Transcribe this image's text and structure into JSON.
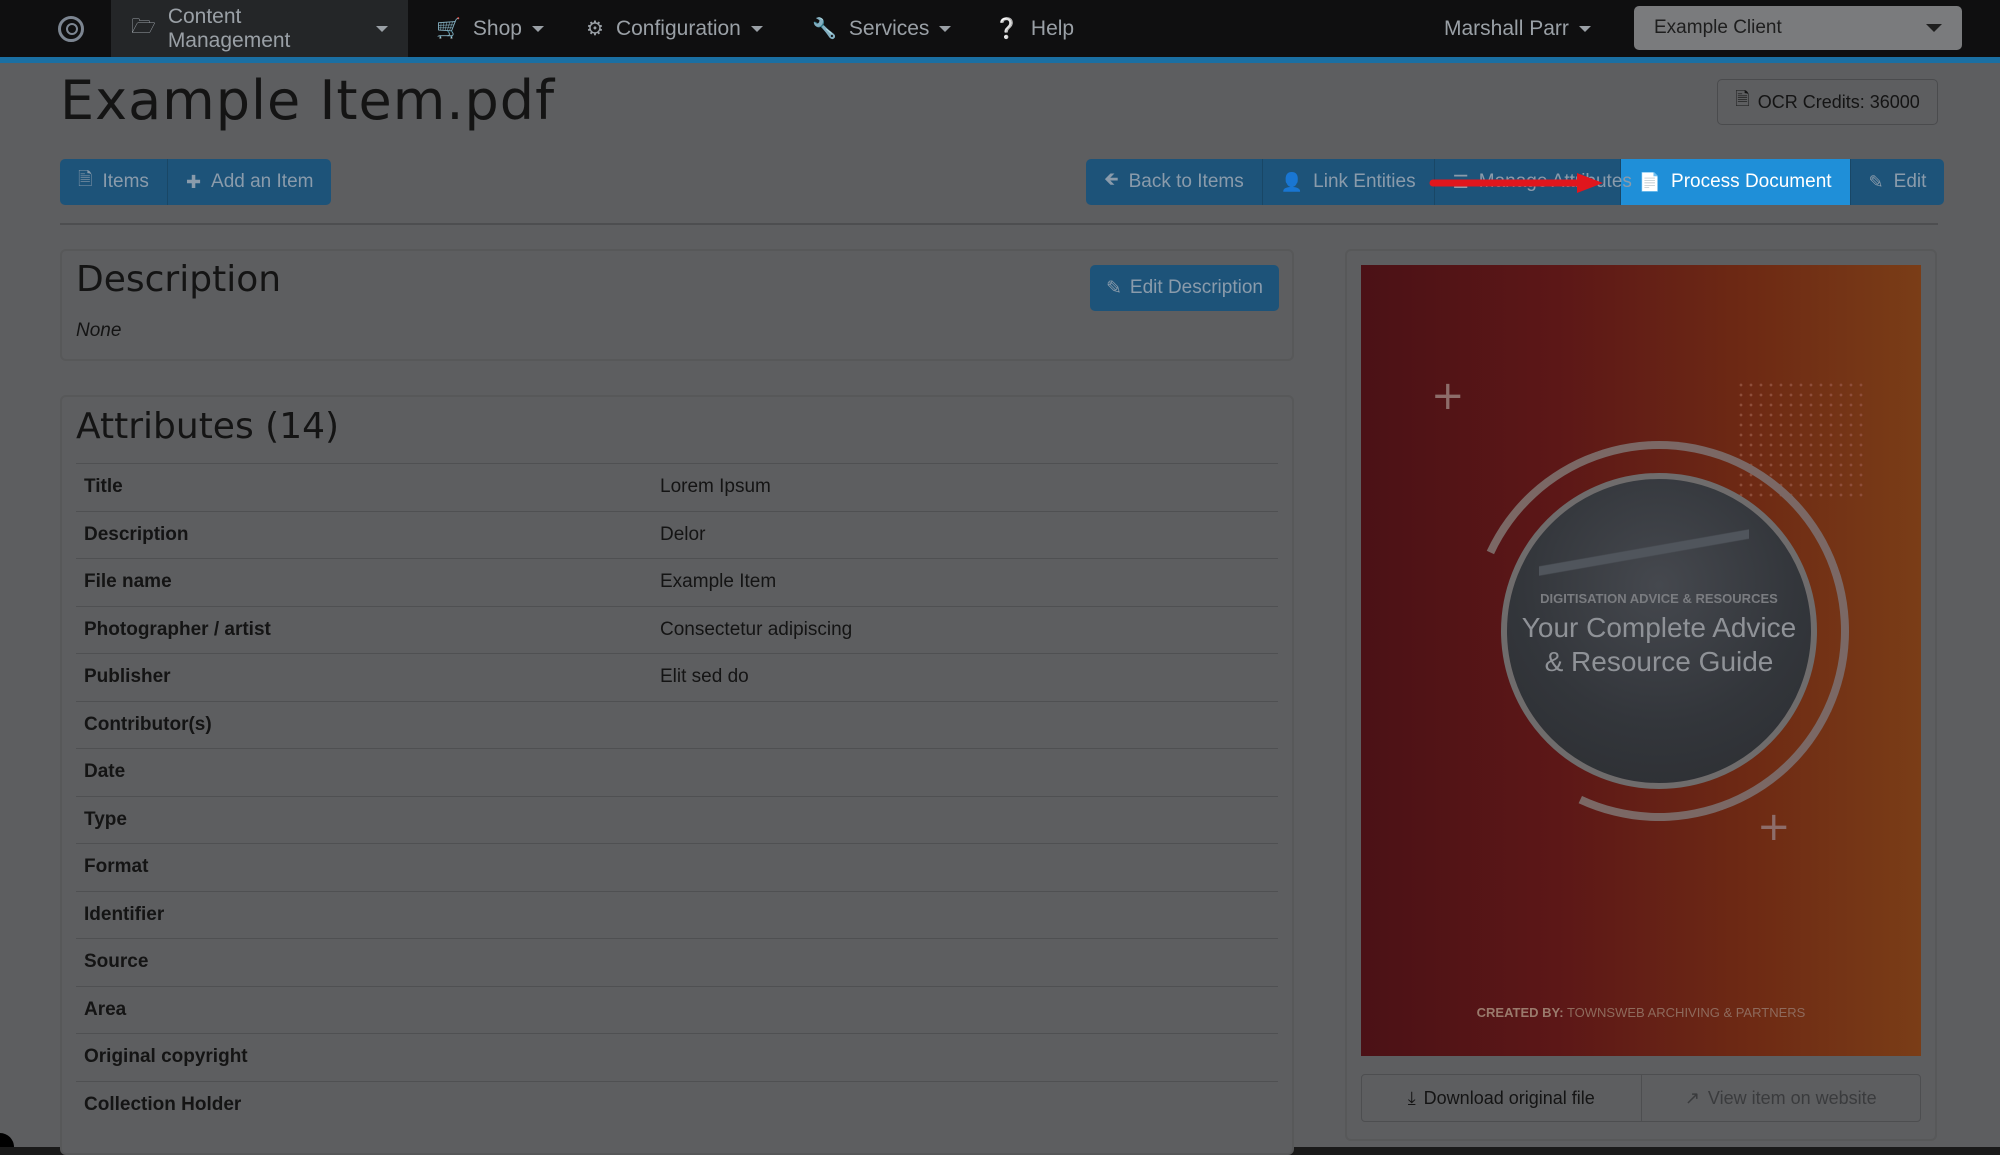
{
  "nav": {
    "items": [
      {
        "label": "Content Management",
        "icon": "folder-open-icon"
      },
      {
        "label": "Shop",
        "icon": "cart-icon"
      },
      {
        "label": "Configuration",
        "icon": "cog-icon"
      },
      {
        "label": "Services",
        "icon": "wrench-icon"
      },
      {
        "label": "Help",
        "icon": "question-circle-icon"
      }
    ],
    "user": "Marshall Parr",
    "client_select": "Example Client"
  },
  "page": {
    "title": "Example Item.pdf",
    "ocr_credits": "OCR Credits: 36000"
  },
  "toolbar_left": {
    "items_label": "Items",
    "add_item_label": "Add an Item"
  },
  "toolbar_right": {
    "back_label": "Back to Items",
    "link_entities_label": "Link Entities",
    "manage_attributes_label": "Manage Attributes",
    "process_document_label": "Process Document",
    "edit_label": "Edit"
  },
  "description": {
    "title": "Description",
    "value": "None",
    "edit_label": "Edit Description"
  },
  "attributes": {
    "title": "Attributes (14)",
    "rows": [
      {
        "key": "Title",
        "value": "Lorem Ipsum"
      },
      {
        "key": "Description",
        "value": "Delor"
      },
      {
        "key": "File name",
        "value": "Example Item"
      },
      {
        "key": "Photographer / artist",
        "value": "Consectetur adipiscing"
      },
      {
        "key": "Publisher",
        "value": "Elit sed do"
      },
      {
        "key": "Contributor(s)",
        "value": ""
      },
      {
        "key": "Date",
        "value": ""
      },
      {
        "key": "Type",
        "value": ""
      },
      {
        "key": "Format",
        "value": ""
      },
      {
        "key": "Identifier",
        "value": ""
      },
      {
        "key": "Source",
        "value": ""
      },
      {
        "key": "Area",
        "value": ""
      },
      {
        "key": "Original copyright",
        "value": ""
      },
      {
        "key": "Collection Holder",
        "value": ""
      }
    ]
  },
  "preview": {
    "kicker": "DIGITISATION ADVICE & RESOURCES",
    "title_line1": "Your Complete Advice",
    "title_line2": "& Resource Guide",
    "credit_prefix": "CREATED BY:",
    "credit_name": "TOWNSWEB ARCHIVING & PARTNERS",
    "download_label": "Download original file",
    "view_label": "View item on website"
  },
  "colors": {
    "accent": "#1f8fd8",
    "annotation_arrow": "#e0161d"
  }
}
